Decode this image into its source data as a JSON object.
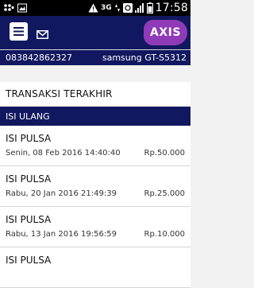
{
  "status_bar": {
    "network": "3G",
    "time": "17:58"
  },
  "header": {
    "logo_text": "AXIS"
  },
  "info": {
    "phone": "083842862327",
    "device": "samsung GT-S5312"
  },
  "section_title": "TRANSAKSI TERAKHIR",
  "category": "ISI ULANG",
  "transactions": [
    {
      "title": "ISI PULSA",
      "date": "Senin, 08 Feb 2016 14:40:40",
      "amount": "Rp.50.000"
    },
    {
      "title": "ISI PULSA",
      "date": "Rabu, 20 Jan 2016 21:49:39",
      "amount": "Rp.25.000"
    },
    {
      "title": "ISI PULSA",
      "date": "Rabu, 13 Jan 2016 19:56:59",
      "amount": "Rp.10.000"
    },
    {
      "title": "ISI PULSA",
      "date": "",
      "amount": ""
    }
  ],
  "colors": {
    "brand_navy": "#11185f",
    "brand_purple": "#8f3bb8"
  },
  "icons": [
    "bbm-icon",
    "image-icon",
    "warning-icon",
    "signal-3g-icon",
    "data-transfer-icon",
    "refresh-icon",
    "signal-icon",
    "battery-icon",
    "menu-icon",
    "mail-icon"
  ]
}
